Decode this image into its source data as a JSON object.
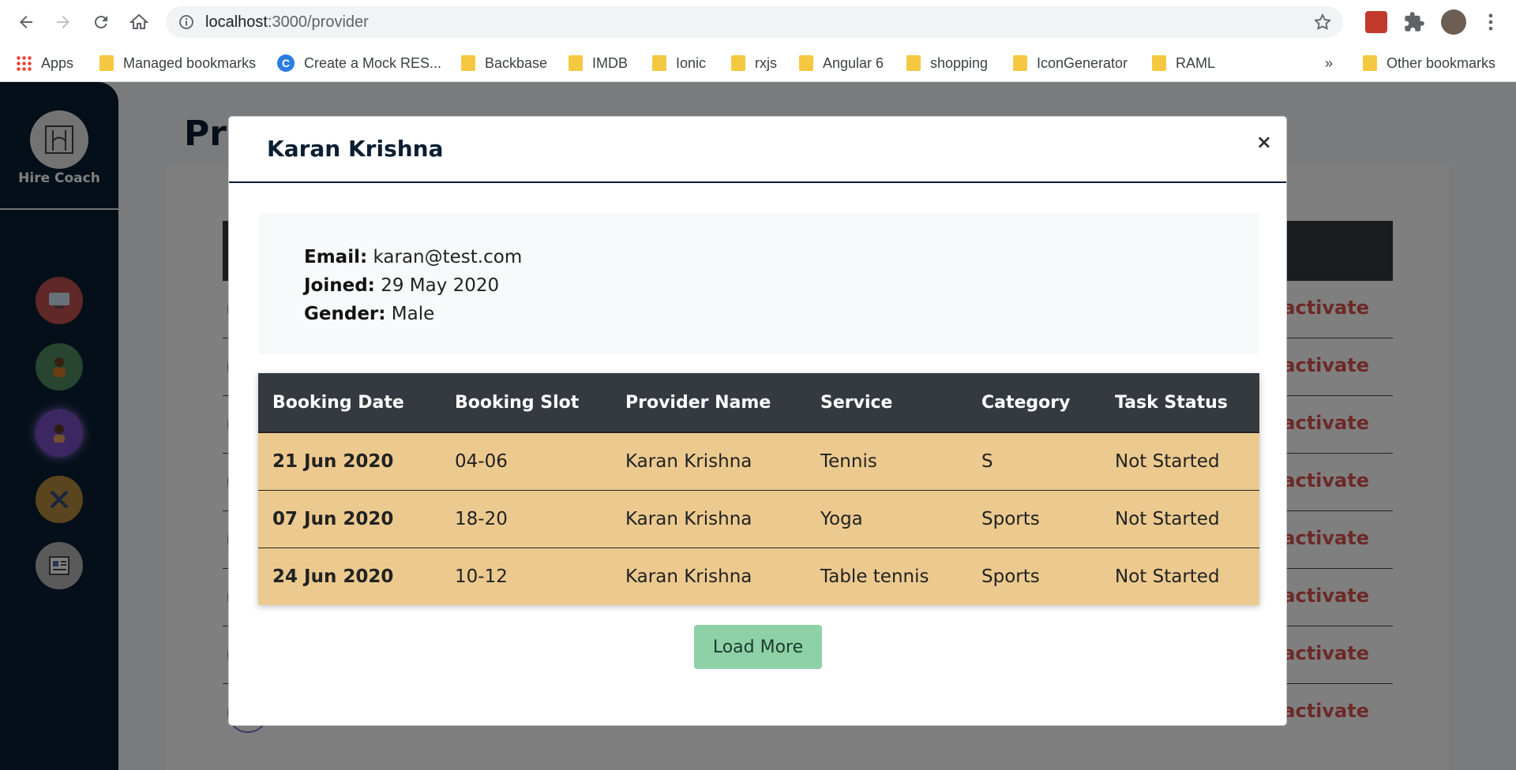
{
  "browser": {
    "url_host": "localhost",
    "url_path": ":3000/provider",
    "bookmarks": [
      {
        "label": "Apps",
        "icon": "apps-grid-icon"
      },
      {
        "label": "Managed bookmarks",
        "icon": "folder-icon"
      },
      {
        "label": "Create a Mock RES...",
        "icon": "site-c-icon"
      },
      {
        "label": "Backbase",
        "icon": "folder-icon"
      },
      {
        "label": "IMDB",
        "icon": "folder-icon"
      },
      {
        "label": "Ionic",
        "icon": "folder-icon"
      },
      {
        "label": "rxjs",
        "icon": "folder-icon"
      },
      {
        "label": "Angular 6",
        "icon": "folder-icon"
      },
      {
        "label": "shopping",
        "icon": "folder-icon"
      },
      {
        "label": "IconGenerator",
        "icon": "folder-icon"
      },
      {
        "label": "RAML",
        "icon": "folder-icon"
      }
    ],
    "overflow": "»",
    "other_bookmarks": "Other bookmarks"
  },
  "sidebar": {
    "brand": "Hire Coach",
    "items": [
      {
        "icon": "dashboard-icon",
        "color": "#c0504d"
      },
      {
        "icon": "coach-icon",
        "color": "#4e8a62"
      },
      {
        "icon": "provider-icon",
        "color": "#7b4fc4"
      },
      {
        "icon": "tools-icon",
        "color": "#b48a3c"
      },
      {
        "icon": "reports-icon",
        "color": "#b5b5b5"
      }
    ]
  },
  "page": {
    "title": "Pr",
    "row_action": "eactivate"
  },
  "modal": {
    "title": "Karan Krishna",
    "close": "×",
    "email_label": "Email:",
    "email_value": "karan@test.com",
    "joined_label": "Joined:",
    "joined_value": "29 May 2020",
    "gender_label": "Gender:",
    "gender_value": "Male",
    "table": {
      "headers": [
        "Booking Date",
        "Booking Slot",
        "Provider Name",
        "Service",
        "Category",
        "Task Status"
      ],
      "rows": [
        [
          "21 Jun 2020",
          "04-06",
          "Karan Krishna",
          "Tennis",
          "S",
          "Not Started"
        ],
        [
          "07 Jun 2020",
          "18-20",
          "Karan Krishna",
          "Yoga",
          "Sports",
          "Not Started"
        ],
        [
          "24 Jun 2020",
          "10-12",
          "Karan Krishna",
          "Table tennis",
          "Sports",
          "Not Started"
        ]
      ]
    },
    "load_more": "Load More"
  },
  "colors": {
    "sidebar_bg": "#0b1f33",
    "table_header": "#343a40",
    "row_bg": "#ecca8f",
    "button_green": "#8fd1a7",
    "deactivate_red": "#d9534f"
  }
}
